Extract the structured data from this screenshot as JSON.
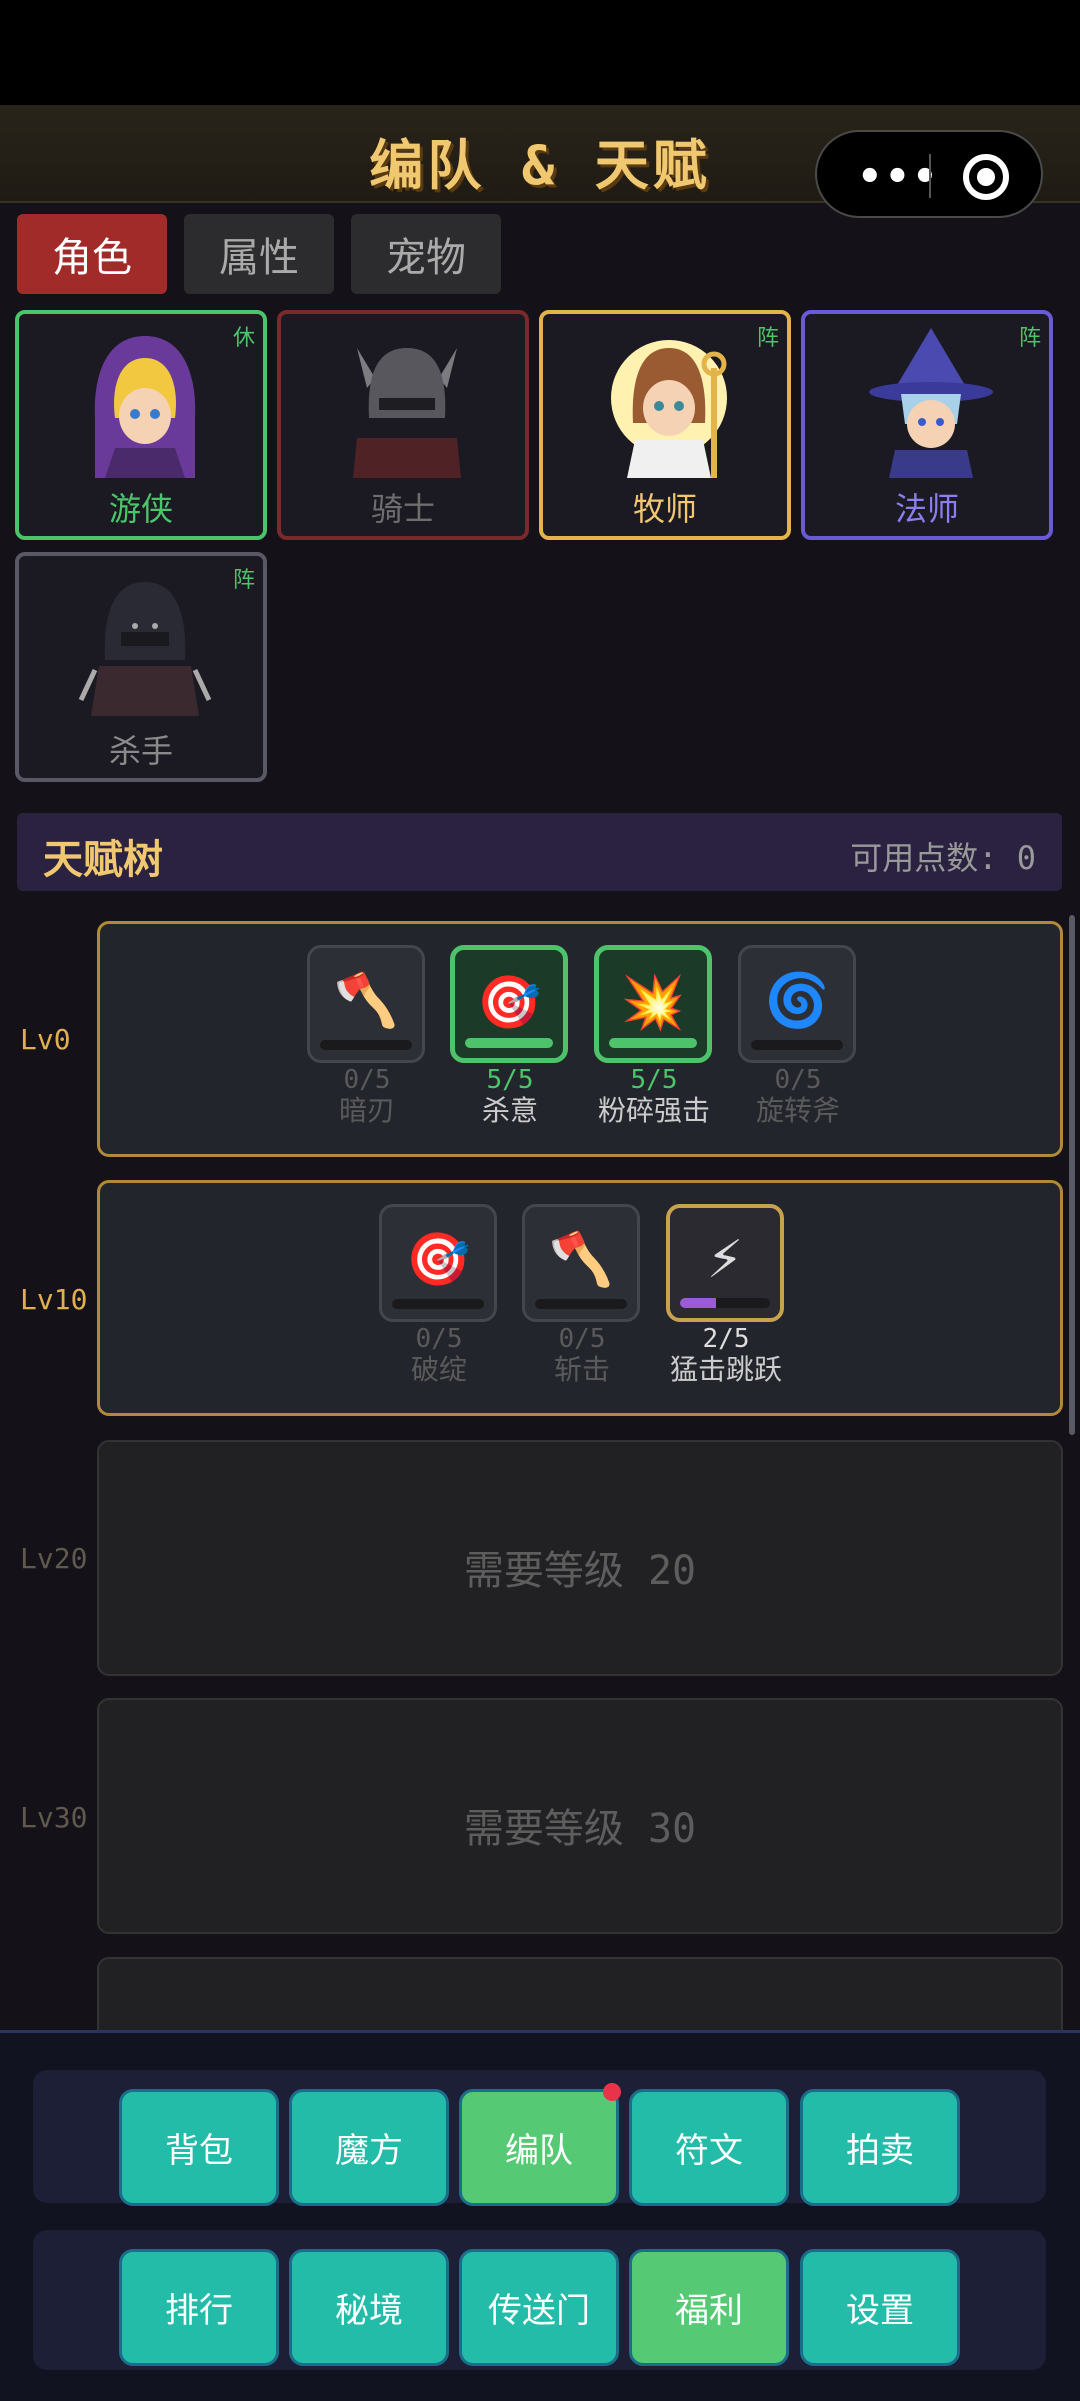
{
  "header": {
    "title": "编队 & 天赋"
  },
  "tabs": [
    {
      "label": "角色",
      "active": true
    },
    {
      "label": "属性",
      "active": false
    },
    {
      "label": "宠物",
      "active": false
    }
  ],
  "heroes": [
    {
      "name": "游侠",
      "badge": "休",
      "border": "#4cc46a",
      "name_color": "#4cc46a"
    },
    {
      "name": "骑士",
      "badge": "",
      "border": "#7a2a2a",
      "name_color": "#6e6e6e"
    },
    {
      "name": "牧师",
      "badge": "阵",
      "border": "#e2b44a",
      "name_color": "#f0c870"
    },
    {
      "name": "法师",
      "badge": "阵",
      "border": "#6b5ad6",
      "name_color": "#8a7ef0"
    },
    {
      "name": "杀手",
      "badge": "阵",
      "border": "#595966",
      "name_color": "#8a8a8a"
    }
  ],
  "talent_tree": {
    "title": "天赋树",
    "points_label": "可用点数: 0",
    "tiers": [
      {
        "level": "Lv0",
        "skills": [
          {
            "name": "暗刃",
            "count": "0/5",
            "progress": 0,
            "icon": "axe-icon",
            "glyph": "🪓",
            "state": "empty"
          },
          {
            "name": "杀意",
            "count": "5/5",
            "progress": 1,
            "icon": "target-icon",
            "glyph": "🎯",
            "state": "maxed"
          },
          {
            "name": "粉碎强击",
            "count": "5/5",
            "progress": 1,
            "icon": "burst-icon",
            "glyph": "💥",
            "state": "maxed"
          },
          {
            "name": "旋转斧",
            "count": "0/5",
            "progress": 0,
            "icon": "whirl-icon",
            "glyph": "🌀",
            "state": "empty"
          }
        ]
      },
      {
        "level": "Lv10",
        "skills": [
          {
            "name": "破绽",
            "count": "0/5",
            "progress": 0,
            "icon": "target-icon",
            "glyph": "🎯",
            "state": "empty"
          },
          {
            "name": "斩击",
            "count": "0/5",
            "progress": 0,
            "icon": "axe-icon",
            "glyph": "🪓",
            "state": "empty"
          },
          {
            "name": "猛击跳跃",
            "count": "2/5",
            "progress": 0.4,
            "icon": "lightning-icon",
            "glyph": "⚡",
            "state": "partial"
          }
        ]
      },
      {
        "level": "Lv20",
        "locked_text": "需要等级 20"
      },
      {
        "level": "Lv30",
        "locked_text": "需要等级 30"
      }
    ]
  },
  "nav": {
    "row1": [
      {
        "label": "背包",
        "style": "teal"
      },
      {
        "label": "魔方",
        "style": "teal"
      },
      {
        "label": "编队",
        "style": "green",
        "dot": true
      },
      {
        "label": "符文",
        "style": "teal"
      },
      {
        "label": "拍卖",
        "style": "teal"
      }
    ],
    "row2": [
      {
        "label": "排行",
        "style": "teal"
      },
      {
        "label": "秘境",
        "style": "teal"
      },
      {
        "label": "传送门",
        "style": "teal"
      },
      {
        "label": "福利",
        "style": "green"
      },
      {
        "label": "设置",
        "style": "teal"
      }
    ]
  }
}
